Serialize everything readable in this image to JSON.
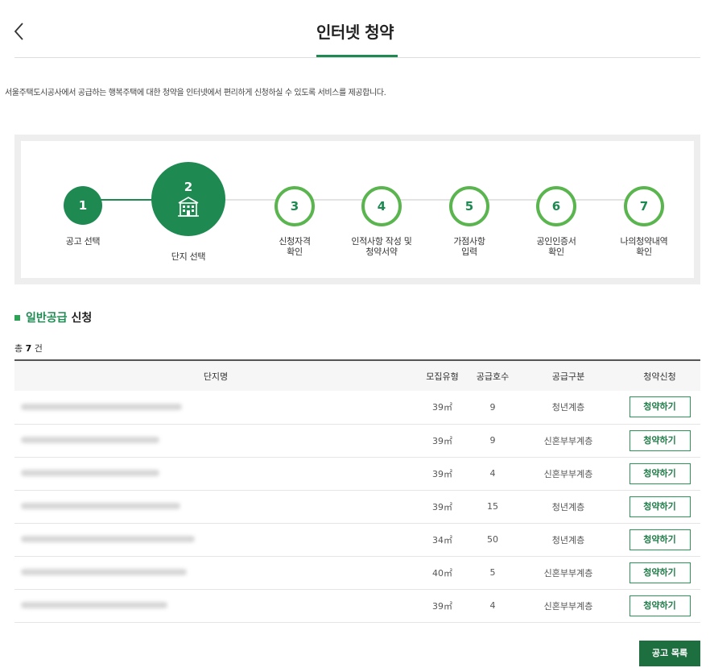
{
  "header": {
    "title": "인터넷 청약"
  },
  "intro": "서울주택도시공사에서 공급하는 행복주택에 대한 청약을 인터넷에서 편리하게 신청하실 수 있도록 서비스를 제공합니다.",
  "steps": [
    {
      "num": "1",
      "label": "공고 선택",
      "state": "done"
    },
    {
      "num": "2",
      "label": "단지 선택",
      "state": "current"
    },
    {
      "num": "3",
      "label_lines": [
        "신청자격",
        "확인"
      ],
      "state": "todo"
    },
    {
      "num": "4",
      "label_lines": [
        "인적사항 작성 및",
        "청약서약"
      ],
      "state": "todo"
    },
    {
      "num": "5",
      "label_lines": [
        "가점사항",
        "입력"
      ],
      "state": "todo"
    },
    {
      "num": "6",
      "label_lines": [
        "공인인증서",
        "확인"
      ],
      "state": "todo"
    },
    {
      "num": "7",
      "label_lines": [
        "나의청약내역",
        "확인"
      ],
      "state": "todo"
    }
  ],
  "section": {
    "title_green": "일반공급",
    "title_rest": "신청"
  },
  "count": {
    "prefix": "총",
    "value": "7",
    "suffix": "건"
  },
  "table": {
    "headers": [
      "단지명",
      "모집유형",
      "공급호수",
      "공급구분",
      "청약신청"
    ],
    "rows": [
      {
        "type": "39㎡",
        "units": "9",
        "category": "청년계층",
        "action": "청약하기"
      },
      {
        "type": "39㎡",
        "units": "9",
        "category": "신혼부부계층",
        "action": "청약하기"
      },
      {
        "type": "39㎡",
        "units": "4",
        "category": "신혼부부계층",
        "action": "청약하기"
      },
      {
        "type": "39㎡",
        "units": "15",
        "category": "청년계층",
        "action": "청약하기"
      },
      {
        "type": "34㎡",
        "units": "50",
        "category": "청년계층",
        "action": "청약하기"
      },
      {
        "type": "40㎡",
        "units": "5",
        "category": "신혼부부계층",
        "action": "청약하기"
      },
      {
        "type": "39㎡",
        "units": "4",
        "category": "신혼부부계층",
        "action": "청약하기"
      }
    ]
  },
  "footer": {
    "list_button": "공고 목록"
  },
  "colors": {
    "primary": "#1e8a52",
    "step_ring": "#5ab54f",
    "button_dark": "#1e6f3f"
  },
  "icons": {
    "back": "chevron-left-icon",
    "current_step": "building-icon"
  }
}
